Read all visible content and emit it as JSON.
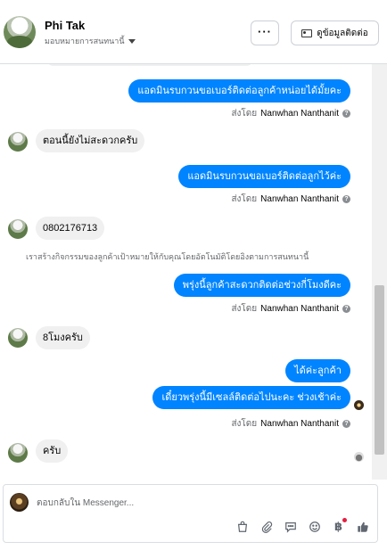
{
  "header": {
    "contact_name": "Phi Tak",
    "assign_label": "มอบหมายการสนทนานี้",
    "more_label": "···",
    "info_button_label": "ดูข้อมูลติดต่อ"
  },
  "messages": [
    {
      "id": "m1",
      "direction": "outgoing",
      "text": "แอดมินรบกวนขอเบอร์ติดต่อลูกค้าหน่อยได้มั้ยคะ"
    },
    {
      "id": "s1",
      "direction": "meta",
      "prefix": "ส่งโดย",
      "sender": "Nanwhan Nanthanit"
    },
    {
      "id": "m2",
      "direction": "incoming",
      "text": "ตอนนี้ยังไม่สะดวกครับ"
    },
    {
      "id": "m3",
      "direction": "outgoing",
      "text": "แอดมินรบกวนขอเบอร์ติดต่อลูกไว้ค่ะ"
    },
    {
      "id": "s2",
      "direction": "meta",
      "prefix": "ส่งโดย",
      "sender": "Nanwhan Nanthanit"
    },
    {
      "id": "m4",
      "direction": "incoming",
      "text": "0802176713"
    },
    {
      "id": "n1",
      "direction": "note",
      "text": "เราสร้างกิจกรรมของลูกค้าเป้าหมายให้กับคุณโดยอัตโนมัติโดยอิงตามการสนทนานี้"
    },
    {
      "id": "m5",
      "direction": "outgoing",
      "text": "พรุ่งนี้ลูกค้าสะดวกติดต่อช่วงกี่โมงดีคะ"
    },
    {
      "id": "s3",
      "direction": "meta",
      "prefix": "ส่งโดย",
      "sender": "Nanwhan Nanthanit"
    },
    {
      "id": "m6",
      "direction": "incoming",
      "text": "8โมงครับ"
    },
    {
      "id": "m7",
      "direction": "outgoing",
      "text": "ได้ค่ะลูกค้า"
    },
    {
      "id": "m8",
      "direction": "outgoing",
      "text": "เดี๋ยวพรุ่งนี้มีเซลล์ติดต่อไปนะคะ ช่วงเช้าค่ะ"
    },
    {
      "id": "s4",
      "direction": "meta",
      "prefix": "ส่งโดย",
      "sender": "Nanwhan Nanthanit"
    },
    {
      "id": "m9",
      "direction": "incoming",
      "text": "ครับ"
    }
  ],
  "composer": {
    "placeholder": "ตอบกลับใน Messenger...",
    "tools": [
      "bag-icon",
      "paperclip-icon",
      "chat-icon",
      "emoji-icon",
      "baht-icon",
      "thumbs-up-icon"
    ],
    "baht_symbol": "฿"
  },
  "colors": {
    "outgoing_bubble": "#0084ff",
    "incoming_bubble": "#f0f0f0",
    "notification_dot": "#e41e3f"
  }
}
